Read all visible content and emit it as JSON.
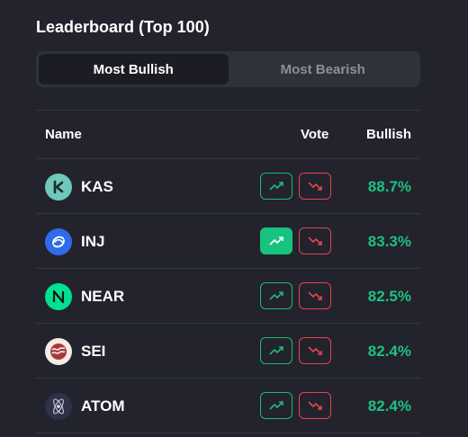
{
  "leaderboard": {
    "title": "Leaderboard (Top 100)",
    "tabs": [
      {
        "label": "Most Bullish",
        "active": true
      },
      {
        "label": "Most Bearish",
        "active": false
      }
    ],
    "columns": {
      "name": "Name",
      "vote": "Vote",
      "bullish": "Bullish"
    },
    "rows": [
      {
        "name": "KAS",
        "bullish": "88.7%",
        "icon": "kaspa-icon",
        "up_selected": false
      },
      {
        "name": "INJ",
        "bullish": "83.3%",
        "icon": "injective-icon",
        "up_selected": true
      },
      {
        "name": "NEAR",
        "bullish": "82.5%",
        "icon": "near-icon",
        "up_selected": false
      },
      {
        "name": "SEI",
        "bullish": "82.4%",
        "icon": "sei-icon",
        "up_selected": false
      },
      {
        "name": "ATOM",
        "bullish": "82.4%",
        "icon": "cosmos-icon",
        "up_selected": false
      }
    ]
  },
  "colors": {
    "background": "#22232c",
    "bullish_green": "#1fc081",
    "bearish_red": "#e0464d"
  }
}
